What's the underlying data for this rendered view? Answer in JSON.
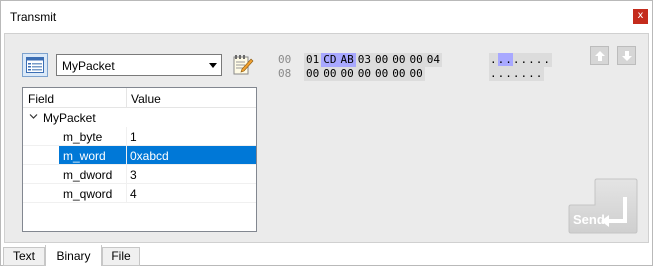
{
  "window": {
    "title": "Transmit",
    "close_label": "x"
  },
  "toolbar": {
    "packet_type": "MyPacket"
  },
  "hex_view": {
    "rows": [
      {
        "offset": "00",
        "bytes": [
          "01",
          "CD",
          "AB",
          "03",
          "00",
          "00",
          "00",
          "04"
        ],
        "selected": [
          1,
          2
        ],
        "ascii": "........",
        "ascii_selected": [
          1,
          2
        ]
      },
      {
        "offset": "08",
        "bytes": [
          "00",
          "00",
          "00",
          "00",
          "00",
          "00",
          "00"
        ],
        "selected": [],
        "ascii": ".......",
        "ascii_selected": []
      }
    ]
  },
  "tree": {
    "columns": {
      "field": "Field",
      "value": "Value"
    },
    "root": "MyPacket",
    "fields": [
      {
        "name": "m_byte",
        "value": "1",
        "selected": false
      },
      {
        "name": "m_word",
        "value": "0xabcd",
        "selected": true
      },
      {
        "name": "m_dword",
        "value": "3",
        "selected": false
      },
      {
        "name": "m_qword",
        "value": "4",
        "selected": false
      }
    ]
  },
  "send_button": {
    "label": "Send"
  },
  "tabs": [
    {
      "label": "Text",
      "active": false
    },
    {
      "label": "Binary",
      "active": true
    },
    {
      "label": "File",
      "active": false
    }
  ],
  "colors": {
    "selection": "#0078d7",
    "hex_highlight": "#a8a8ff",
    "close": "#c42b1c"
  }
}
